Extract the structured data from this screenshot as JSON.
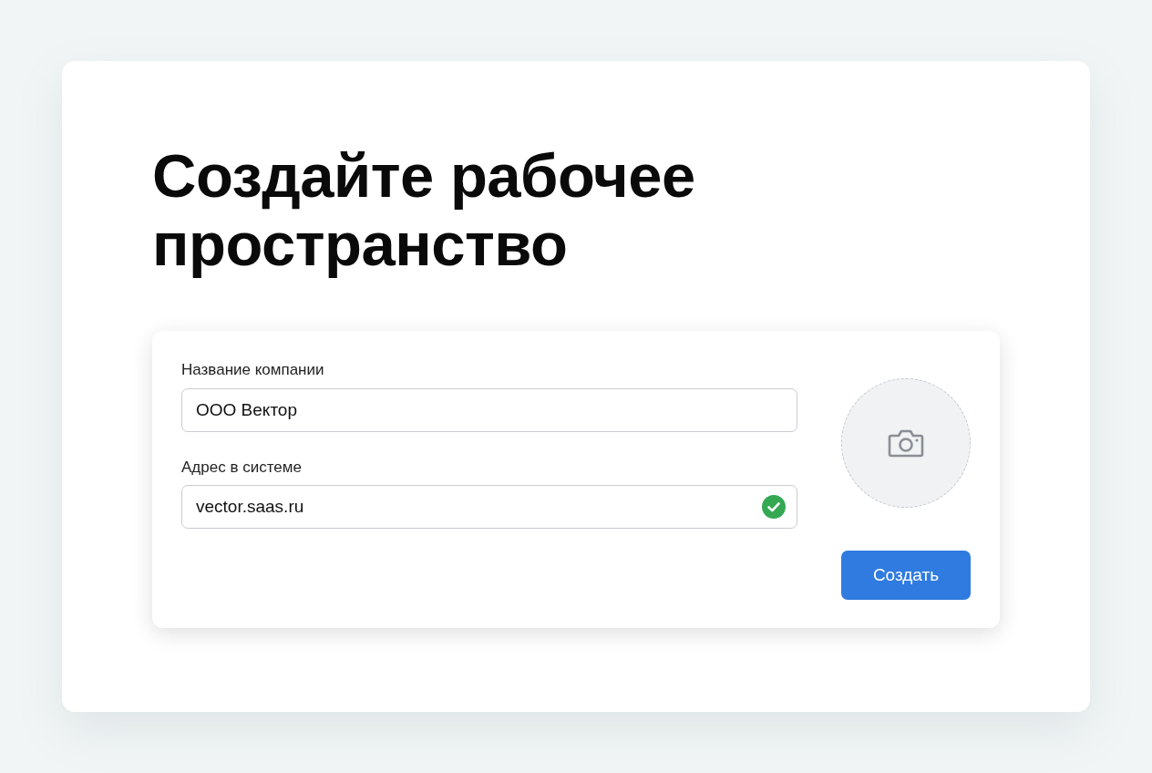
{
  "title": "Создайте рабочее пространство",
  "form": {
    "fields": [
      {
        "label": "Название компании",
        "value": "ООО Вектор",
        "valid": false
      },
      {
        "label": "Адрес в системе",
        "value": "vector.saas.ru",
        "valid": true
      }
    ],
    "submit": "Создать"
  }
}
